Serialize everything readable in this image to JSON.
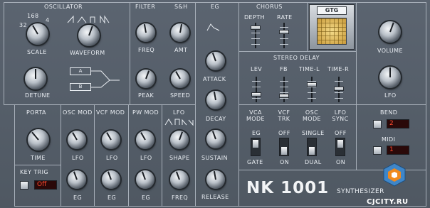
{
  "oscillator": {
    "title": "OSCILLATOR",
    "scale_label": "SCALE",
    "scale_marks": [
      "16",
      "8",
      "4",
      "32"
    ],
    "waveform_label": "WAVEFORM",
    "detune_label": "DETUNE",
    "osc_a": "A",
    "osc_b": "B"
  },
  "filter": {
    "title": "FILTER",
    "freq_label": "FREQ",
    "peak_label": "PEAK"
  },
  "sh": {
    "title": "S&H",
    "amt_label": "AMT",
    "speed_label": "SPEED"
  },
  "eg": {
    "title": "EG",
    "attack_label": "ATTACK",
    "decay_label": "DECAY",
    "sustain_label": "SUSTAIN",
    "release_label": "RELEASE"
  },
  "chorus": {
    "title": "CHORUS",
    "depth_label": "DEPTH",
    "rate_label": "RATE"
  },
  "gtg": {
    "label": "GTG"
  },
  "master": {
    "volume_label": "VOLUME",
    "lfo_label": "LFO"
  },
  "stereo_delay": {
    "title": "STEREO DELAY",
    "lev_label": "LEV",
    "fb_label": "FB",
    "time_l_label": "TIME-L",
    "time_r_label": "TIME-R"
  },
  "modes": {
    "vca_mode": "VCA MODE",
    "vcf_trk": "VCF TRK",
    "osc_mode": "OSC MODE",
    "lfo_sync": "LFO SYNC",
    "eg": "EG",
    "gate": "GATE",
    "off1": "OFF",
    "on1": "ON",
    "single": "SINGLE",
    "dual": "DUAL",
    "off2": "OFF",
    "on2": "ON"
  },
  "bend": {
    "label": "BEND",
    "value": "2"
  },
  "midi": {
    "label": "MIDI",
    "value": "1"
  },
  "porta": {
    "title": "PORTA",
    "time_label": "TIME"
  },
  "osc_mod": {
    "title": "OSC MOD",
    "lfo_label": "LFO",
    "eg_label": "EG"
  },
  "vcf_mod": {
    "title": "VCF MOD",
    "lfo_label": "LFO",
    "eg_label": "EG"
  },
  "pw_mod": {
    "title": "PW MOD",
    "lfo_label": "LFO",
    "eg_label": "EG"
  },
  "lfo": {
    "title": "LFO",
    "shape_label": "SHAPE",
    "freq_label": "FREQ"
  },
  "key_trig": {
    "label": "KEY TRIG",
    "value": "Off"
  },
  "brand": {
    "name": "NK 1001",
    "subtitle": "SYNTHESIZER",
    "watermark": "CJCITY.RU"
  },
  "colors": {
    "panel": "#535c66",
    "display_text": "#ff4a2e",
    "gtg_screen": "#e8c46a"
  }
}
